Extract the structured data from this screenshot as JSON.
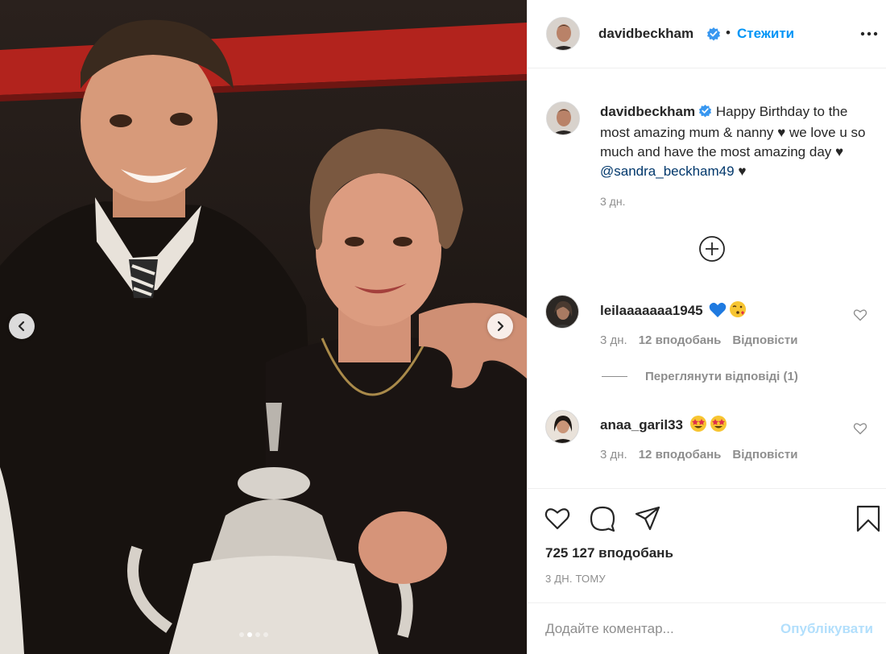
{
  "post": {
    "author": "davidbeckham",
    "follow_separator": "•",
    "follow_label": "Стежити",
    "caption_before_mention": "Happy Birthday to the most amazing mum & nanny ♥ we love u so much and have the most amazing day ♥ ",
    "caption_mention": "@sandra_beckham49",
    "caption_after_mention": " ♥",
    "caption_time": "3 дн.",
    "likes": "725 127 вподобань",
    "date": "3 ДН. ТОМУ",
    "carousel": {
      "total": 4,
      "active": 2
    }
  },
  "comments": [
    {
      "user": "leilaaaaaaa1945",
      "emoji": [
        "blue-heart",
        "face-blowing-kiss"
      ],
      "time": "3 дн.",
      "likes": "12 вподобань",
      "reply_label": "Відповісти"
    },
    {
      "user": "anaa_garil33",
      "emoji": [
        "star-struck",
        "star-struck"
      ],
      "time": "3 дн.",
      "likes": "12 вподобань",
      "reply_label": "Відповісти"
    }
  ],
  "view_replies_label": "Переглянути відповіді (1)",
  "add_comment": {
    "placeholder": "Додайте коментар...",
    "publish_label": "Опублікувати"
  },
  "icons": {
    "header_more": "more-horizontal-icon",
    "load_more": "plus-circle-icon",
    "like": "heart-icon",
    "comment": "comment-icon",
    "share": "send-icon",
    "save": "bookmark-icon",
    "verified": "verified-badge-icon"
  },
  "colors": {
    "link_blue": "#0095f6",
    "publish_disabled": "#b2dffc",
    "verified_blue": "#3897f0",
    "mention": "#00376b",
    "muted": "#8e8e8e"
  }
}
